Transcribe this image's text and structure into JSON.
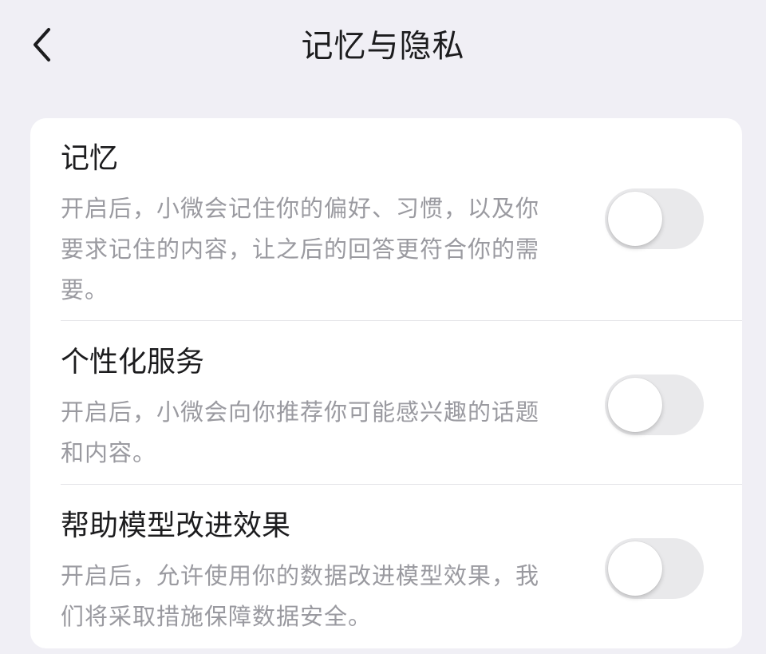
{
  "header": {
    "title": "记忆与隐私",
    "back_icon": "chevron-left-icon"
  },
  "settings": [
    {
      "title": "记忆",
      "description": "开启后，小微会记住你的偏好、习惯，以及你要求记住的内容，让之后的回答更符合你的需要。",
      "enabled": false
    },
    {
      "title": "个性化服务",
      "description": "开启后，小微会向你推荐你可能感兴趣的话题和内容。",
      "enabled": false
    },
    {
      "title": "帮助模型改进效果",
      "description": "开启后，允许使用你的数据改进模型效果，我们将采取措施保障数据安全。",
      "enabled": false
    }
  ],
  "colors": {
    "background": "#f0eff5",
    "card": "#ffffff",
    "title_text": "#1c1c1e",
    "secondary_text": "#9a9aa0",
    "toggle_off": "#e9e9eb"
  }
}
